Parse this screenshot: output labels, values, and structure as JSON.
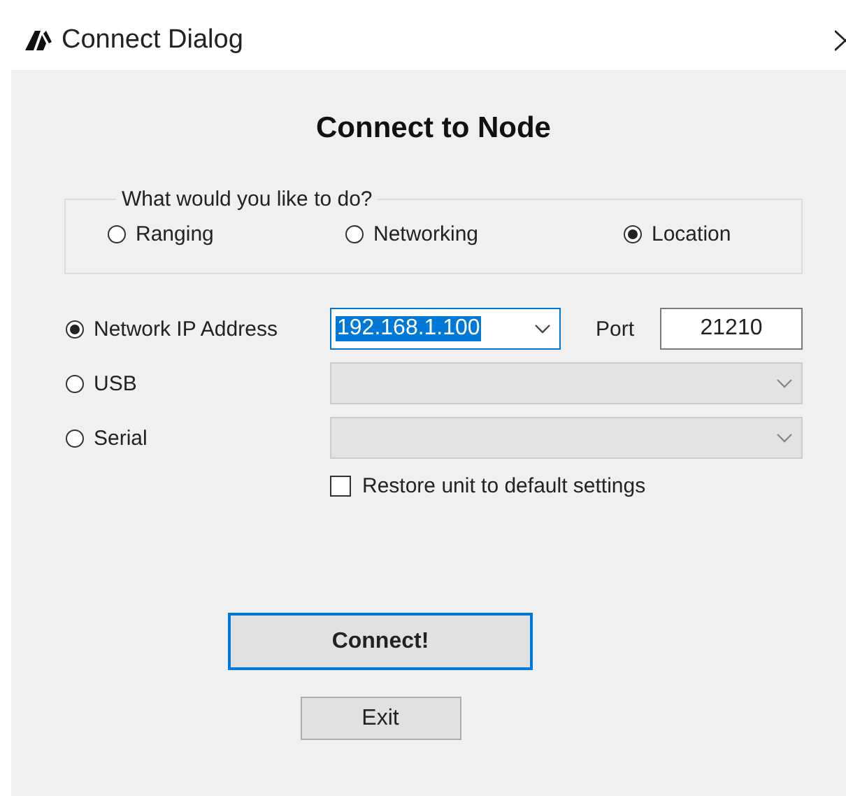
{
  "window": {
    "title": "Connect Dialog"
  },
  "heading": "Connect to Node",
  "mode_group": {
    "label": "What would you like to do?",
    "options": [
      {
        "label": "Ranging",
        "selected": false
      },
      {
        "label": "Networking",
        "selected": false
      },
      {
        "label": "Location",
        "selected": true
      }
    ]
  },
  "connections": [
    {
      "kind": "ip",
      "label": "Network IP Address",
      "selected": true,
      "value": "192.168.1.100",
      "value_highlighted": true,
      "disabled": false,
      "port_label": "Port",
      "port_value": "21210"
    },
    {
      "kind": "combo",
      "label": "USB",
      "selected": false,
      "disabled": true
    },
    {
      "kind": "combo",
      "label": "Serial",
      "selected": false,
      "disabled": true
    }
  ],
  "restore": {
    "label": "Restore unit to default settings",
    "checked": false
  },
  "buttons": [
    {
      "label": "Connect!",
      "default": true
    },
    {
      "label": "Exit",
      "default": false
    }
  ]
}
